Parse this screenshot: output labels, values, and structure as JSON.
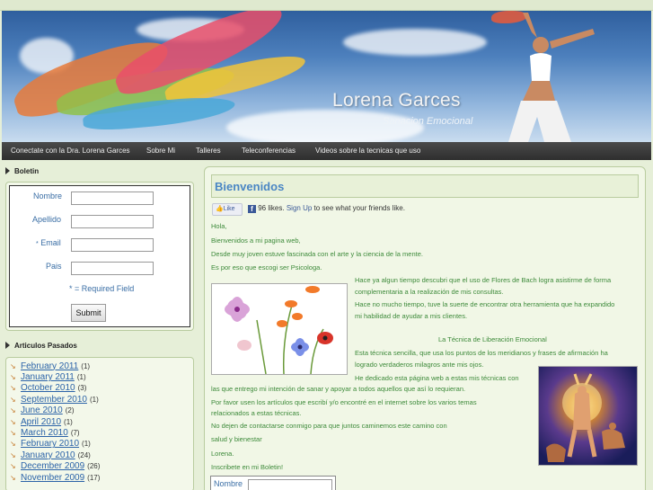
{
  "header": {
    "title": "Lorena Garces",
    "subtitle": "Sanacion Emocional"
  },
  "nav": {
    "items": [
      {
        "label": "Conectate con la Dra. Lorena Garces"
      },
      {
        "label": "Sobre Mi"
      },
      {
        "label": "Talleres"
      },
      {
        "label": "Teleconferencias"
      },
      {
        "label": "Videos sobre la tecnicas que uso"
      }
    ]
  },
  "sidebar": {
    "newsletter": {
      "heading": "Boletin",
      "fields": [
        {
          "label": "Nombre",
          "value": ""
        },
        {
          "label": "Apellido",
          "value": ""
        },
        {
          "label": "Email",
          "value": "",
          "required_marker": "*"
        },
        {
          "label": "Pais",
          "value": ""
        }
      ],
      "required_note": "* = Required Field",
      "submit_label": "Submit"
    },
    "archives": {
      "heading": "Articulos Pasados",
      "items": [
        {
          "label": "February 2011",
          "count": "(1)"
        },
        {
          "label": "January 2011",
          "count": "(1)"
        },
        {
          "label": "October 2010",
          "count": "(3)"
        },
        {
          "label": "September 2010",
          "count": "(1)"
        },
        {
          "label": "June 2010",
          "count": "(2)"
        },
        {
          "label": "April 2010",
          "count": "(1)"
        },
        {
          "label": "March 2010",
          "count": "(7)"
        },
        {
          "label": "February 2010",
          "count": "(1)"
        },
        {
          "label": "January 2010",
          "count": "(24)"
        },
        {
          "label": "December 2009",
          "count": "(26)"
        },
        {
          "label": "November 2009",
          "count": "(17)"
        }
      ]
    }
  },
  "content": {
    "title": "Bienvenidos",
    "facebook": {
      "like_label": "Like",
      "likes_text": "96 likes.",
      "signup_label": "Sign Up",
      "signup_suffix": "to see what your friends like."
    },
    "paragraphs": [
      "Hola,",
      "Bienvenidos a mi pagina web,",
      "Desde muy joven estuve fascinada con el arte y la ciencia de la mente.",
      "Es por eso que escogi ser Psicologa.",
      "Hace ya algun tiempo descubri que el uso de Flores de Bach logra asistirme de forma",
      "complementaria a la realización de mis consultas.",
      "Hace no mucho tiempo, tuve la suerte de encontrar otra herramienta que ha expandido",
      "mi habilidad de ayudar a mis clientes.",
      "La Técnica de Liberación Emocional",
      "Esta técnica sencilla, que usa los puntos de los meridianos y frases de afirmación ha",
      "logrado verdaderos milagros ante mis ojos.",
      "He dedicado esta página web a estas mis técnicas con",
      "las que entrego mi intención de sanar y apoyar a todos aquellos que así lo requieran.",
      "Por favor usen los artículos que escribí y/o encontré en el internet sobre los varios temas",
      "relacionados a estas técnicas.",
      "No dejen de contactarse conmigo para que juntos caminemos este camino con",
      "salud y bienestar",
      "Lorena.",
      "Inscribete en mi Boletin!"
    ],
    "bottom_form_label": "Nombre"
  }
}
